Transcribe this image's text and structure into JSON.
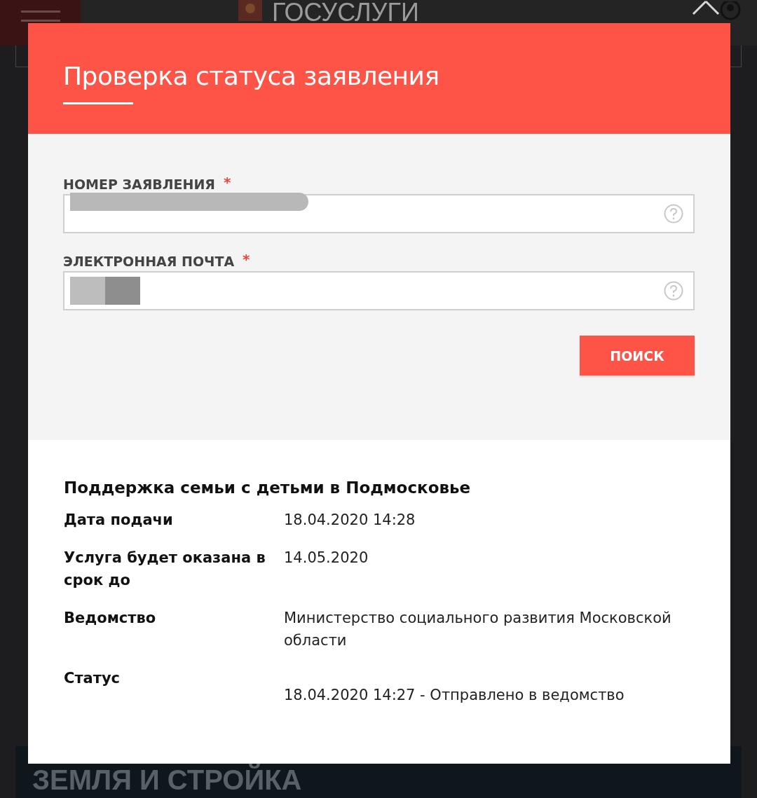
{
  "background": {
    "logo_text": "ГОСУСЛУГИ",
    "banner_title": "ЗЕМЛЯ И СТРОЙКА"
  },
  "dialog": {
    "title": "Проверка статуса заявления",
    "fields": [
      {
        "label": "НОМЕР ЗАЯВЛЕНИЯ",
        "required_mark": "*"
      },
      {
        "label": "ЭЛЕКТРОННАЯ ПОЧТА",
        "required_mark": "*"
      }
    ],
    "search_button": "ПОИСК",
    "result": {
      "title": "Поддержка семьи с детьми в Подмосковье",
      "rows": [
        {
          "kind": "plain",
          "label": "Дата подачи",
          "value": "18.04.2020 14:28"
        },
        {
          "kind": "plain",
          "label": "Услуга будет оказана в срок до",
          "value": "14.05.2020"
        },
        {
          "kind": "plain",
          "label": "Ведомство",
          "value": "Министерство социального развития Московской области"
        },
        {
          "kind": "status",
          "label": "Статус",
          "value": "18.04.2020 14:27 - Отправлено в ведомство"
        }
      ]
    }
  }
}
